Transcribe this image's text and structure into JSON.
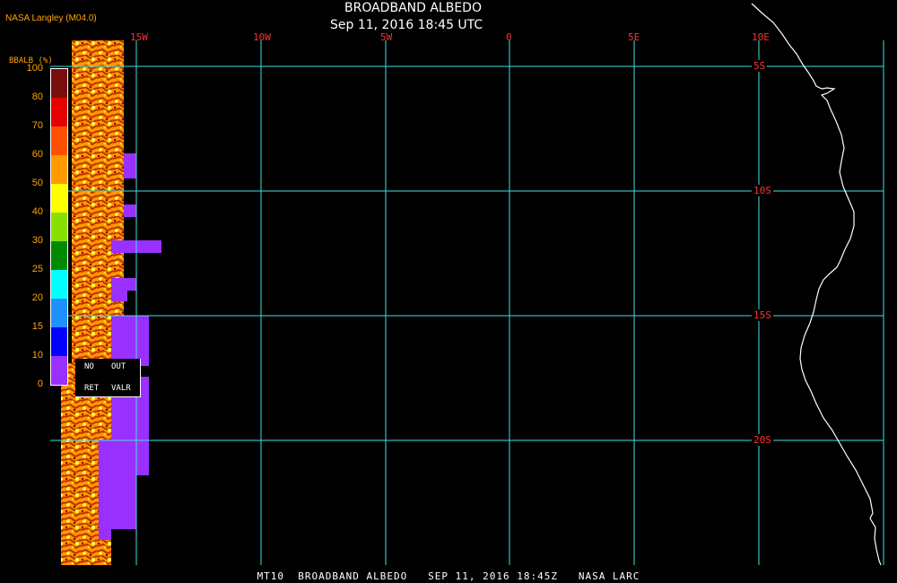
{
  "header": {
    "title": "BROADBAND ALBEDO",
    "datetime": "Sep 11, 2016 18:45 UTC",
    "org": "NASA Langley (M04.0)"
  },
  "footer": "MT10  BROADBAND ALBEDO   SEP 11, 2016 18:45Z   NASA LARC",
  "grid": {
    "lon_labels": [
      "15W",
      "10W",
      "5W",
      "0",
      "5E",
      "10E"
    ],
    "lat_labels": [
      "5S",
      "10S",
      "15S",
      "20S"
    ],
    "line_color": "#40e0e0",
    "label_color": "#ff3030"
  },
  "legend": {
    "title": "BBALB (%)",
    "ticks": [
      "100",
      "80",
      "70",
      "60",
      "50",
      "40",
      "30",
      "25",
      "20",
      "15",
      "10",
      "0"
    ],
    "colors": [
      "#7a0d0d",
      "#e60000",
      "#ff5000",
      "#ff9a00",
      "#ffff00",
      "#88e000",
      "#008a00",
      "#00ffff",
      "#1e90ff",
      "#0000ff",
      "#9a30ff"
    ],
    "no_retrieval": {
      "line1": "NO",
      "line2": "RET",
      "fill": "#9a30ff"
    },
    "out_valr": {
      "line1": "OUT",
      "line2": "VALR"
    }
  },
  "colors": {
    "background": "#000000",
    "coastline": "#ffffff",
    "no_retrieval": "#9a30ff",
    "label": "#ffa500"
  }
}
